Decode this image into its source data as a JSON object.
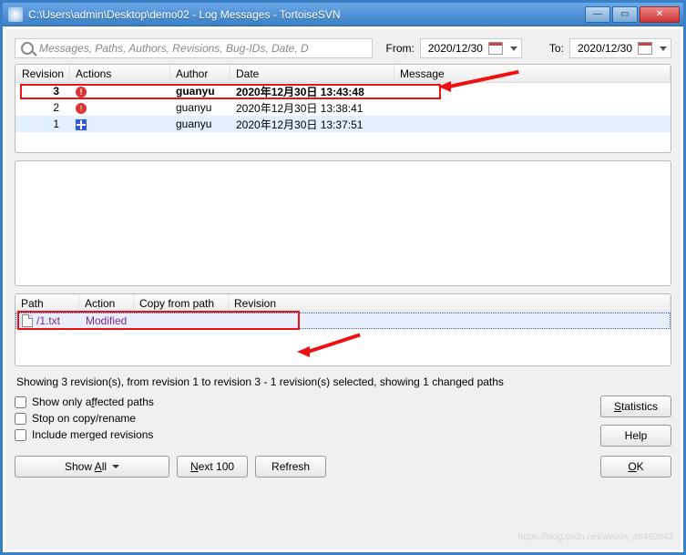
{
  "title": "C:\\Users\\admin\\Desktop\\demo02 - Log Messages - TortoiseSVN",
  "search": {
    "placeholder": "Messages, Paths, Authors, Revisions, Bug-IDs, Date, D"
  },
  "labels": {
    "from": "From:",
    "to": "To:"
  },
  "dates": {
    "from": "2020/12/30",
    "to": "2020/12/30"
  },
  "log": {
    "headers": {
      "revision": "Revision",
      "actions": "Actions",
      "author": "Author",
      "date": "Date",
      "message": "Message"
    },
    "rows": [
      {
        "revision": "3",
        "author": "guanyu",
        "date": "2020年12月30日 13:43:48",
        "icon": "warn"
      },
      {
        "revision": "2",
        "author": "guanyu",
        "date": "2020年12月30日 13:38:41",
        "icon": "warn"
      },
      {
        "revision": "1",
        "author": "guanyu",
        "date": "2020年12月30日 13:37:51",
        "icon": "plus"
      }
    ]
  },
  "files": {
    "headers": {
      "path": "Path",
      "action": "Action",
      "copy": "Copy from path",
      "revision": "Revision"
    },
    "rows": [
      {
        "path": "/1.txt",
        "action": "Modified"
      }
    ]
  },
  "status": "Showing 3 revision(s), from revision 1 to revision 3 - 1 revision(s) selected, showing 1 changed paths",
  "checks": {
    "affected": "Show only affected paths",
    "stop": "Stop on copy/rename",
    "merged": "Include merged revisions"
  },
  "buttons": {
    "statistics": "Statistics",
    "help": "Help",
    "showall": "Show All",
    "next100": "Next 100",
    "refresh": "Refresh",
    "ok": "OK"
  },
  "watermark": "https://blog.csdn.net/weixin_46460843"
}
